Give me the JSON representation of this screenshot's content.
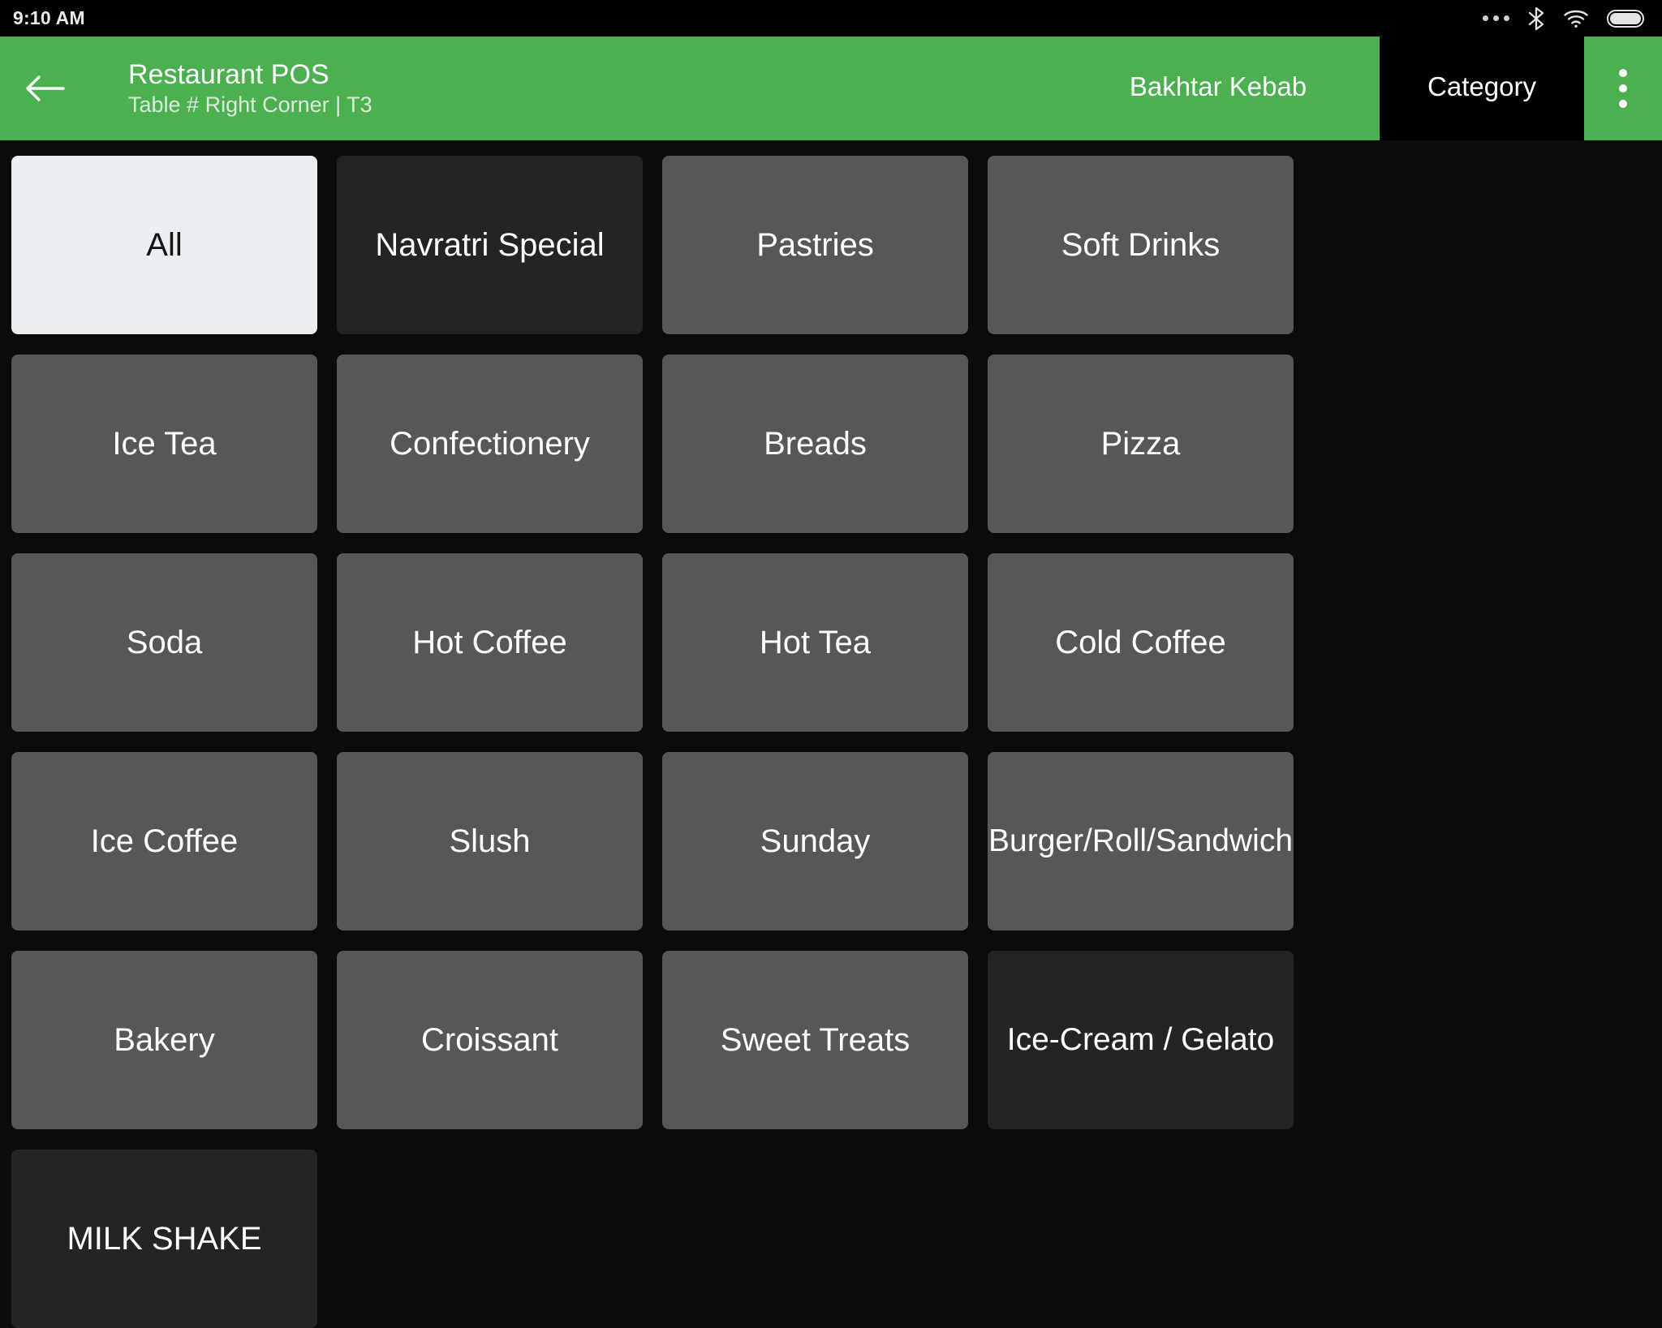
{
  "statusbar": {
    "time": "9:10 AM",
    "icons": [
      "more-horizontal-icon",
      "bluetooth-icon",
      "wifi-icon",
      "battery-icon"
    ]
  },
  "appbar": {
    "back_icon": "arrow-left-icon",
    "title": "Restaurant POS",
    "subtitle": "Table # Right Corner | T3",
    "overflow_icon": "overflow-menu-icon",
    "accent_color": "#4CAF50",
    "tabs": [
      {
        "label": "Bakhtar Kebab",
        "selected": false
      },
      {
        "label": "Category",
        "selected": true
      }
    ]
  },
  "categories": [
    {
      "label": "All",
      "state": "selected"
    },
    {
      "label": "Navratri Special",
      "state": "dark"
    },
    {
      "label": "Pastries",
      "state": "normal"
    },
    {
      "label": "Soft Drinks",
      "state": "normal"
    },
    {
      "label": "Ice Tea",
      "state": "normal"
    },
    {
      "label": "Confectionery",
      "state": "normal"
    },
    {
      "label": "Breads",
      "state": "normal"
    },
    {
      "label": "Pizza",
      "state": "normal"
    },
    {
      "label": "Soda",
      "state": "normal"
    },
    {
      "label": "Hot Coffee",
      "state": "normal"
    },
    {
      "label": "Hot Tea",
      "state": "normal"
    },
    {
      "label": "Cold Coffee",
      "state": "normal"
    },
    {
      "label": "Ice Coffee",
      "state": "normal"
    },
    {
      "label": "Slush",
      "state": "normal"
    },
    {
      "label": "Sunday",
      "state": "normal"
    },
    {
      "label": "Burger/Roll/Sandwich",
      "state": "normal"
    },
    {
      "label": "Bakery",
      "state": "normal"
    },
    {
      "label": "Croissant",
      "state": "normal"
    },
    {
      "label": "Sweet Treats",
      "state": "normal"
    },
    {
      "label": "Ice-Cream / Gelato",
      "state": "dark"
    },
    {
      "label": "MILK SHAKE",
      "state": "dark"
    }
  ],
  "colors": {
    "accent": "#4CAF50",
    "tile": "#575757",
    "tile_dark": "#242424",
    "tile_selected": "#ECEFF1",
    "background": "#0b0b0b"
  }
}
